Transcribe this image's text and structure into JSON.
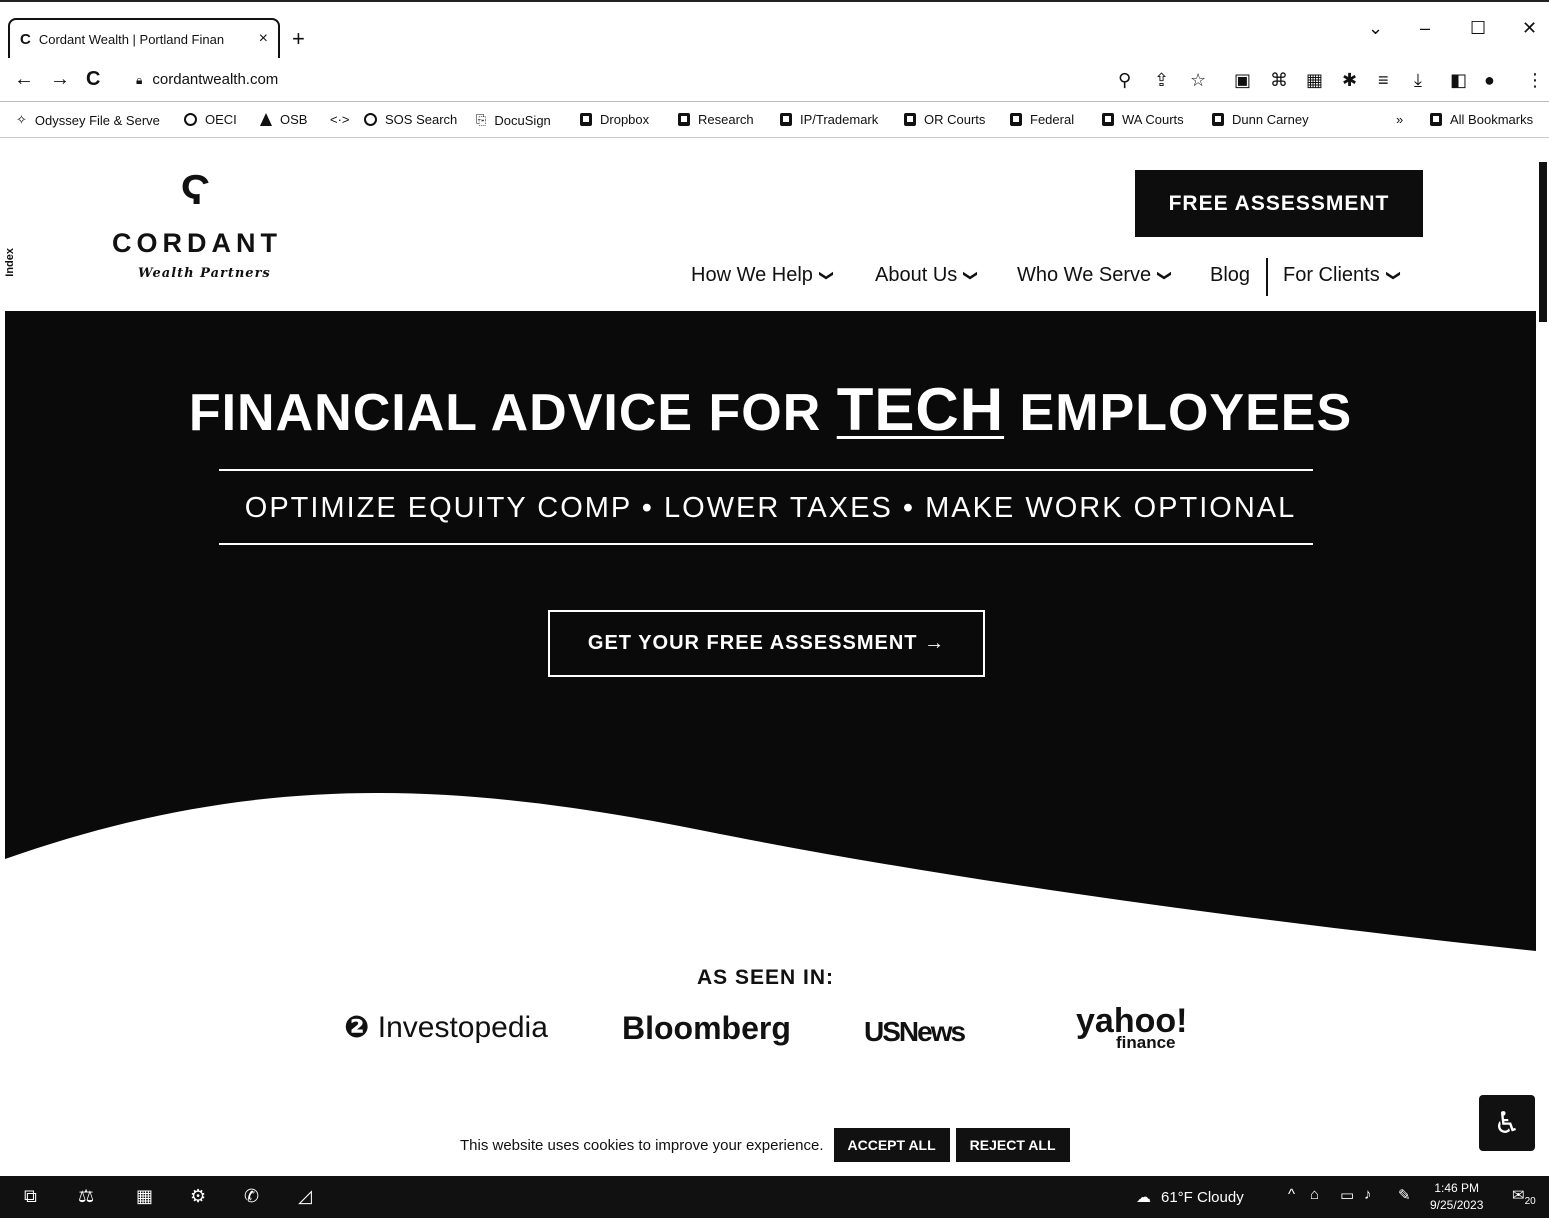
{
  "browser": {
    "tab_favicon": "C",
    "tab_title": "Cordant Wealth | Portland Finan",
    "tab_close": "×",
    "new_tab": "+",
    "url": "cordantwealth.com",
    "window_controls": {
      "dropdown": "⌄",
      "minimize": "–",
      "maximize": "☐",
      "close": "✕"
    },
    "bookmarks": [
      {
        "label": "Odyssey File & Serve",
        "icon": "odyssey-icon"
      },
      {
        "label": "OECI",
        "icon": "globe-icon"
      },
      {
        "label": "OSB",
        "icon": "triangle-icon"
      },
      {
        "label": "SOS Search",
        "icon": "globe-icon"
      },
      {
        "label": "DocuSign",
        "icon": "docusign-icon"
      },
      {
        "label": "Dropbox",
        "icon": "dropbox-icon"
      },
      {
        "label": "Research",
        "icon": "folder-icon"
      },
      {
        "label": "IP/Trademark",
        "icon": "folder-icon"
      },
      {
        "label": "OR Courts",
        "icon": "folder-icon"
      },
      {
        "label": "Federal",
        "icon": "folder-icon"
      },
      {
        "label": "WA Courts",
        "icon": "folder-icon"
      },
      {
        "label": "Dunn Carney",
        "icon": "folder-icon"
      }
    ],
    "bookmarks_overflow": "»",
    "all_bookmarks": "All Bookmarks"
  },
  "site": {
    "side_tab": "Index",
    "logo_mark": "Ϛ",
    "logo_name": "CORDANT",
    "logo_sub": "Wealth Partners",
    "header_cta": "FREE ASSESSMENT",
    "nav": {
      "how_we_help": "How We Help",
      "about_us": "About Us",
      "who_we_serve": "Who We Serve",
      "blog": "Blog",
      "for_clients": "For Clients"
    },
    "hero": {
      "title_pre": "FINANCIAL ADVICE FOR",
      "title_tech": "TECH",
      "title_post": "EMPLOYEES",
      "subtitle": "OPTIMIZE EQUITY COMP  •  LOWER TAXES  •  MAKE WORK OPTIONAL",
      "cta": "GET YOUR FREE ASSESSMENT  →"
    },
    "seen_in": "AS SEEN IN:",
    "media": {
      "investopedia": "Investopedia",
      "bloomberg": "Bloomberg",
      "usnews": "USNews",
      "yahoo": "yahoo!",
      "yahoo_sub": "finance"
    },
    "cookie": {
      "text": "This website uses cookies to improve your experience.",
      "accept": "ACCEPT ALL",
      "reject": "REJECT ALL"
    }
  },
  "taskbar": {
    "weather": "61°F  Cloudy",
    "time": "1:46 PM",
    "date": "9/25/2023",
    "notifications": "20"
  }
}
